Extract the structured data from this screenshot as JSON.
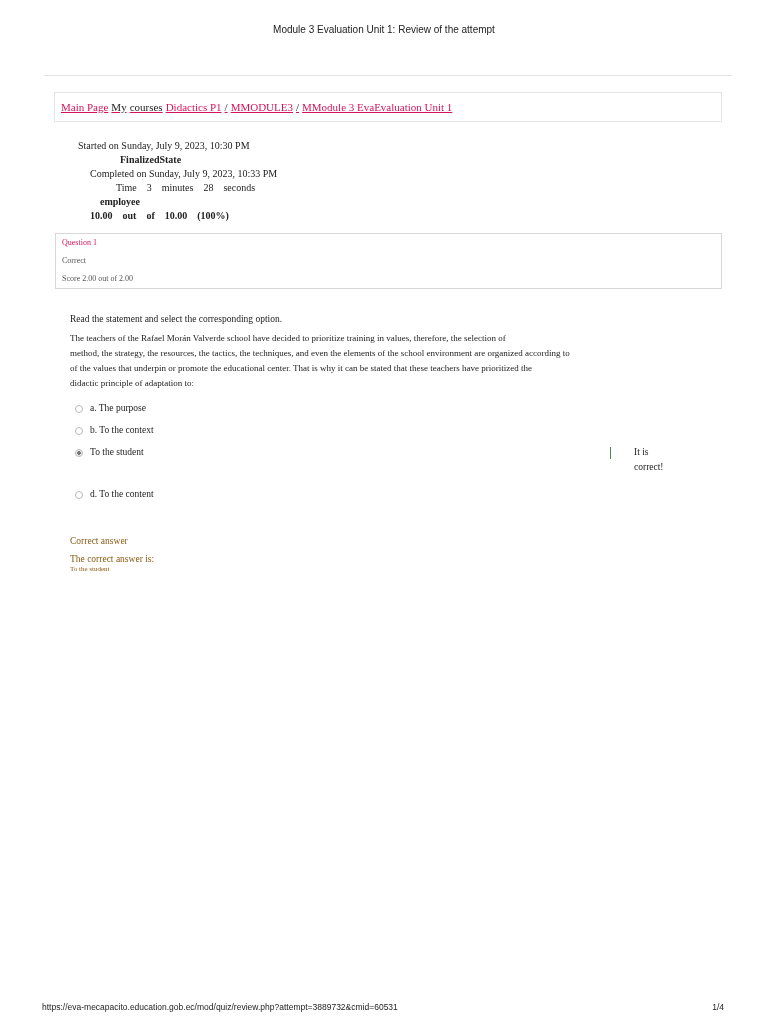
{
  "print_header": {
    "title": "Module 3 Evaluation Unit 1: Review of the attempt"
  },
  "breadcrumb": [
    {
      "text": "Main Page",
      "kind": "link"
    },
    {
      "text": "My",
      "kind": "text"
    },
    {
      "text": "courses",
      "kind": "text"
    },
    {
      "text": "Didactics P1",
      "kind": "link"
    },
    {
      "text": "/",
      "kind": "text"
    },
    {
      "text": "MMODULE3",
      "kind": "link"
    },
    {
      "text": "/",
      "kind": "text"
    },
    {
      "text": "MModule 3 EvaEvaluation Unit 1",
      "kind": "link"
    }
  ],
  "summary": [
    {
      "text": "Started on Sunday, July 9, 2023, 10:30 PM",
      "kind": "started"
    },
    {
      "text": "FinalizedState",
      "kind": "state"
    },
    {
      "text": "Completed on Sunday, July 9, 2023, 10:33 PM",
      "kind": "completed"
    },
    {
      "text": "Time    3    minutes    28    seconds",
      "kind": "time"
    },
    {
      "text": "employee",
      "kind": "user"
    },
    {
      "text": "10.00    out    of    10.00    (100%)",
      "kind": "grade"
    }
  ],
  "question_info": {
    "number": "Question 1",
    "state": "Correct",
    "grade": "Score 2.00 out of 2.00"
  },
  "question": {
    "instruction": "Read the statement and select the corresponding option.",
    "lines": [
      "The teachers of the Rafael Morán Valverde school have decided to prioritize training in values, therefore, the selection of",
      "method, the strategy, the resources, the tactics, the techniques, and even the elements of the school environment are organized according to",
      "of the values that underpin or promote the educational center. That is why it can be stated that these teachers have prioritized the",
      "didactic principle of adaptation to:"
    ],
    "options": [
      {
        "label": "a. The purpose",
        "selected": false
      },
      {
        "label": "b. To the context",
        "selected": false
      },
      {
        "label": "To the student",
        "selected": true,
        "feedback": "It is correct!"
      },
      {
        "label": "d. To the content",
        "selected": false
      }
    ]
  },
  "outcome": {
    "title": "Correct answer",
    "heading": "The correct answer is:",
    "answer": "To the student"
  },
  "print_footer": {
    "url": "https://eva-mecapacito.education.gob.ec/mod/quiz/review.php?attempt=3889732&cmid=60531",
    "page": "1/4"
  }
}
